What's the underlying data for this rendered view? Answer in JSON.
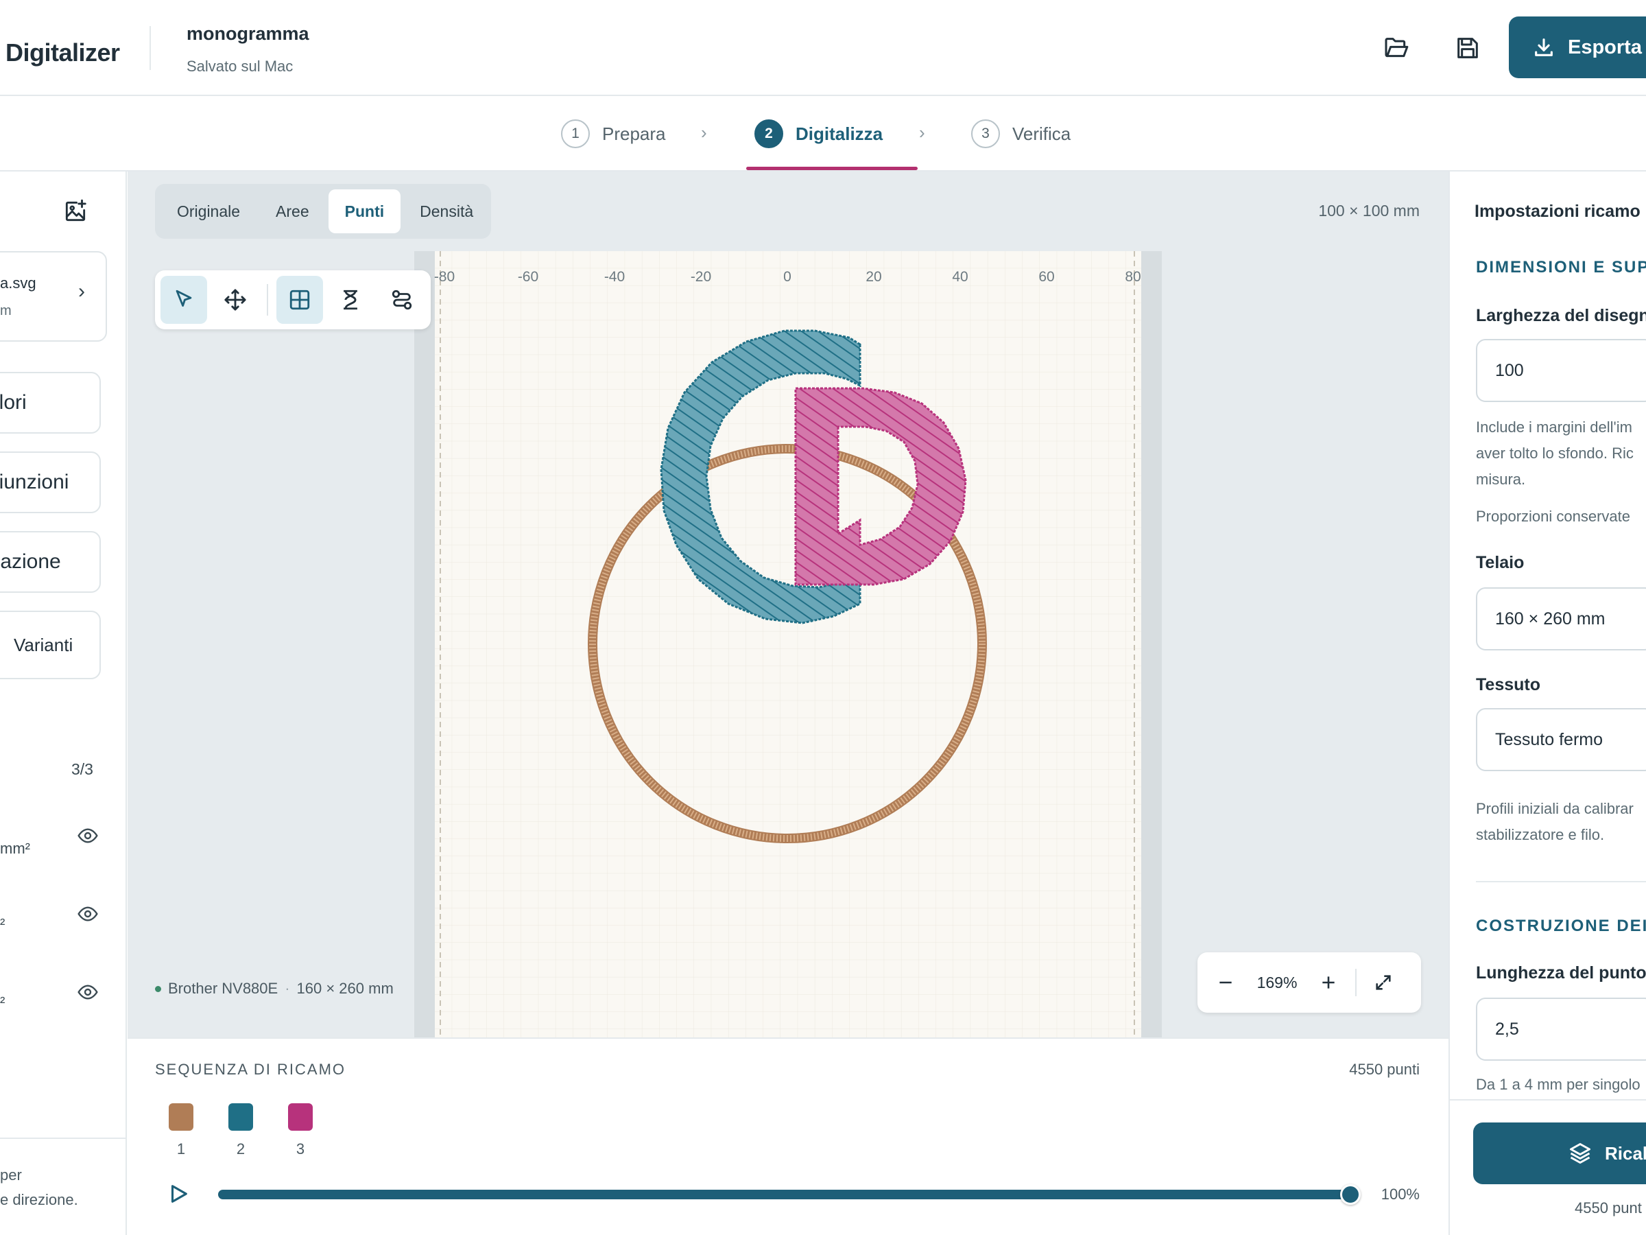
{
  "header": {
    "app_name": "Digitalizer",
    "doc_name": "monogramma",
    "doc_status": "Salvato sul Mac",
    "export_label": "Esporta"
  },
  "stepper": {
    "steps": [
      {
        "num": "1",
        "label": "Prepara"
      },
      {
        "num": "2",
        "label": "Digitalizza"
      },
      {
        "num": "3",
        "label": "Verifica"
      }
    ],
    "active_step": 2
  },
  "left": {
    "file_name": "a.svg",
    "file_sub": "m",
    "buttons": [
      "olori",
      "giunzioni",
      "trazione",
      "Varianti"
    ],
    "layer_count": "3/3",
    "layer_areas": [
      "mm²",
      "²",
      "²"
    ],
    "footer_lines": [
      "per",
      "e direzione."
    ]
  },
  "canvas": {
    "view_tabs": [
      "Originale",
      "Aree",
      "Punti",
      "Densità"
    ],
    "active_view": "Punti",
    "size_label": "100 × 100 mm",
    "ruler_ticks": [
      "-80",
      "-60",
      "-40",
      "-20",
      "0",
      "20",
      "40",
      "60",
      "80"
    ],
    "machine": "Brother NV880E",
    "machine_hoop": "160 × 260 mm",
    "zoom": "169%",
    "tools": [
      "select-tool",
      "move-tool",
      "grid-tool",
      "fill-tool",
      "path-tool"
    ]
  },
  "sequence": {
    "title": "SEQUENZA DI RICAMO",
    "count": "4550 punti",
    "colors": [
      {
        "num": "1",
        "color": "#b07d56"
      },
      {
        "num": "2",
        "color": "#1f6f86"
      },
      {
        "num": "3",
        "color": "#b7327c"
      }
    ],
    "progress": 1.0,
    "progress_label": "100%"
  },
  "right": {
    "title": "Impostazioni ricamo",
    "section1": "DIMENSIONI E SUP",
    "width_label": "Larghezza del disegno",
    "width_value": "100",
    "width_help": [
      "Include i margini dell'im",
      "aver tolto lo sfondo. Ric",
      "misura."
    ],
    "proportions": "Proporzioni conservate",
    "hoop_label": "Telaio",
    "hoop_value": "160 × 260 mm",
    "fabric_label": "Tessuto",
    "fabric_value": "Tessuto fermo",
    "fabric_help": [
      "Profili iniziali da calibrar",
      "stabilizzatore e filo."
    ],
    "section2": "COSTRUZIONE DEI",
    "stitch_len_label": "Lunghezza del punto",
    "stitch_len_value": "2,5",
    "stitch_len_help": "Da 1 a 4 mm per singolo",
    "recalc_label": "Ricalc",
    "footer_count": "4550 punt"
  },
  "colors": {
    "accent": "#1d5f78",
    "highlight": "#b3306f",
    "thread_ring": "#b07d56",
    "thread_c": "#1f6f86",
    "thread_d": "#b7327c"
  }
}
